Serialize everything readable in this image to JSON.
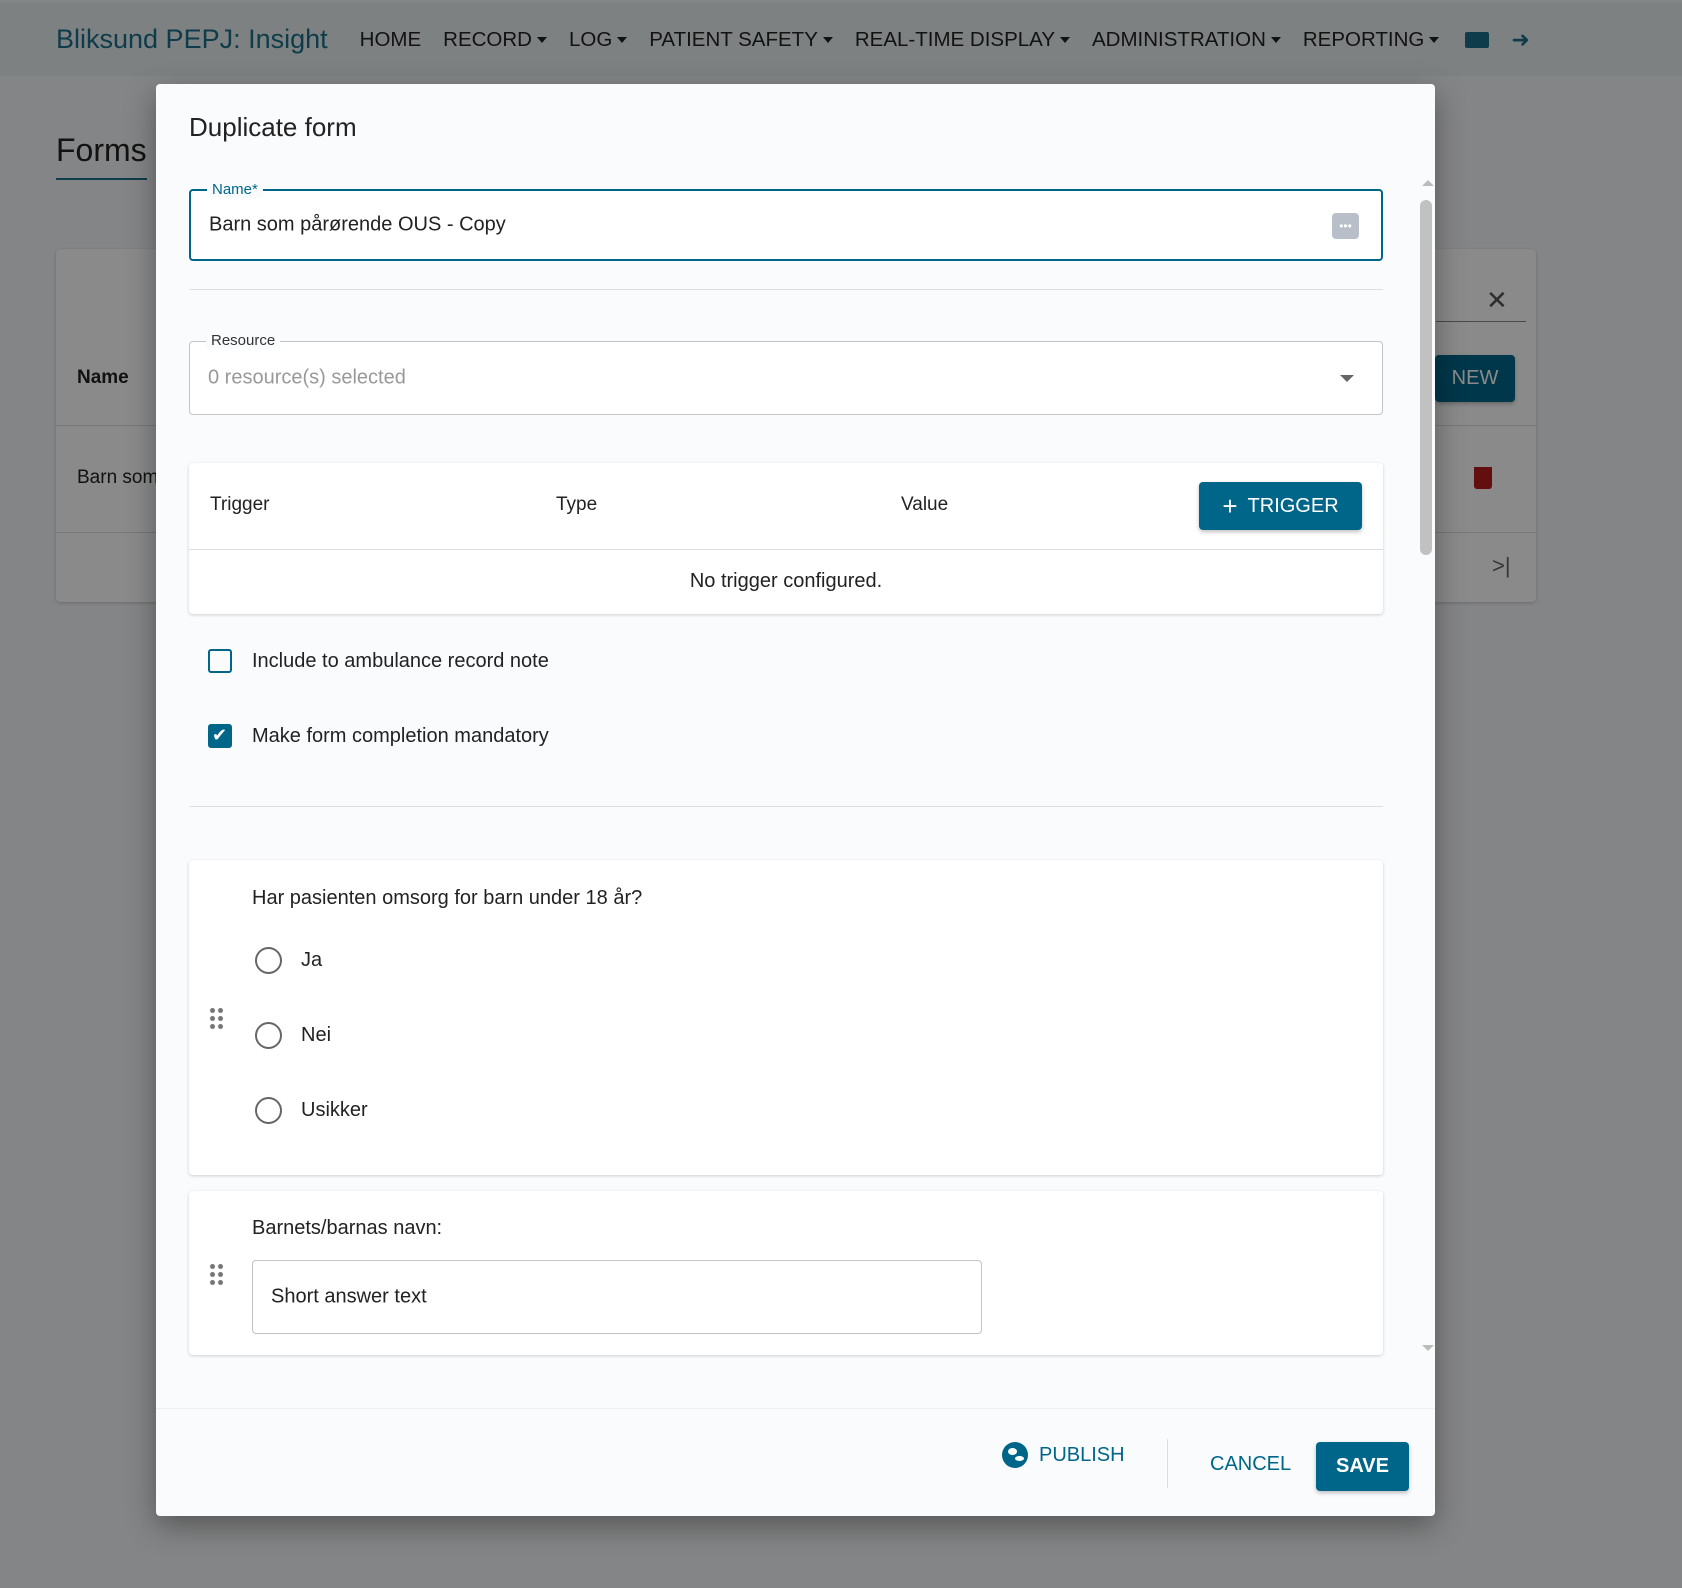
{
  "nav": {
    "brand": "Bliksund PEPJ: Insight",
    "items": [
      {
        "label": "HOME",
        "dropdown": false
      },
      {
        "label": "RECORD",
        "dropdown": true
      },
      {
        "label": "LOG",
        "dropdown": true
      },
      {
        "label": "PATIENT SAFETY",
        "dropdown": true
      },
      {
        "label": "REAL-TIME DISPLAY",
        "dropdown": true
      },
      {
        "label": "ADMINISTRATION",
        "dropdown": true
      },
      {
        "label": "REPORTING",
        "dropdown": true
      }
    ],
    "icons": [
      "language-icon",
      "logout-icon"
    ]
  },
  "background": {
    "page_title": "Forms",
    "table_header_name": "Name",
    "row_name": "Barn som",
    "new_button": "NEW"
  },
  "dialog": {
    "title": "Duplicate form",
    "name_label": "Name*",
    "name_value": "Barn som pårørende OUS - Copy",
    "resource_label": "Resource",
    "resource_placeholder": "0 resource(s) selected",
    "trigger_table": {
      "columns": [
        "Trigger",
        "Type",
        "Value"
      ],
      "add_button": "TRIGGER",
      "empty": "No trigger configured."
    },
    "checkboxes": [
      {
        "label": "Include to ambulance record note",
        "checked": false
      },
      {
        "label": "Make form completion mandatory",
        "checked": true
      }
    ],
    "questions": [
      {
        "text": "Har pasienten omsorg for barn under 18 år?",
        "options": [
          "Ja",
          "Nei",
          "Usikker"
        ]
      },
      {
        "text": "Barnets/barnas navn:",
        "placeholder": "Short answer text"
      }
    ],
    "footer": {
      "publish": "PUBLISH",
      "cancel": "CANCEL",
      "save": "SAVE"
    }
  },
  "colors": {
    "primary": "#006689",
    "danger": "#b71c1c"
  }
}
